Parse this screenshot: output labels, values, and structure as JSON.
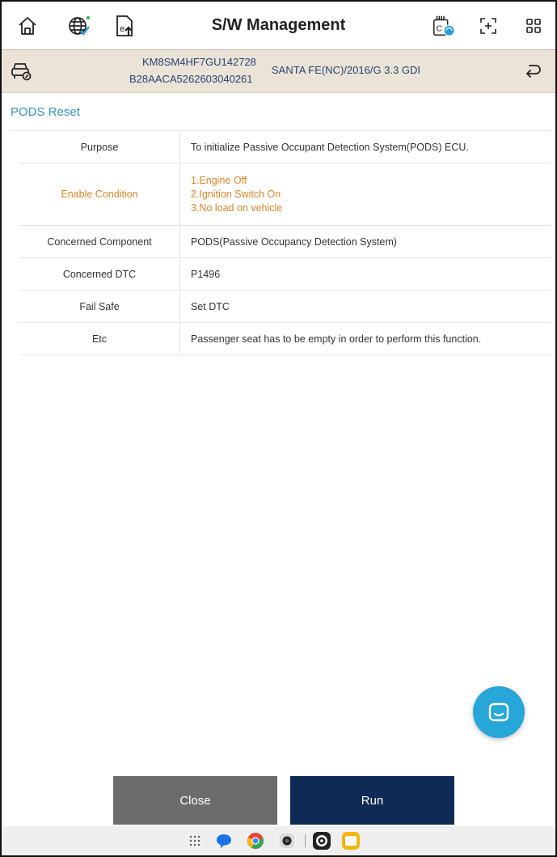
{
  "toolbar": {
    "title": "S/W Management",
    "icons": [
      "home-icon",
      "globe-check-icon",
      "ecu-upload-icon",
      "vci-status-icon",
      "screen-capture-icon",
      "menu-grid-icon"
    ]
  },
  "vehicle": {
    "vin": "KM8SM4HF7GU142728",
    "ecu_id": "B28AACA5262603040261",
    "model": "SANTA FE(NC)/2016/G 3.3 GDI"
  },
  "section": {
    "title": "PODS Reset"
  },
  "table": {
    "rows": [
      {
        "label": "Purpose",
        "value": "To initialize Passive Occupant Detection System(PODS) ECU."
      },
      {
        "label": "Enable Condition",
        "conditions": [
          "1.Engine Off",
          "2.Ignition Switch On",
          "3.No load on vehicle"
        ]
      },
      {
        "label": "Concerned Component",
        "value": "PODS(Passive Occupancy Detection System)"
      },
      {
        "label": "Concerned DTC",
        "value": "P1496"
      },
      {
        "label": "Fail Safe",
        "value": "Set DTC"
      },
      {
        "label": "Etc",
        "value": "Passenger seat has to be empty in order to perform this function."
      }
    ]
  },
  "buttons": {
    "close": "Close",
    "run": "Run"
  },
  "colors": {
    "accent": "#3a8fbf",
    "condition": "#d9852b",
    "run_button": "#0f2b55",
    "close_button": "#6c6c6c",
    "fab": "#27a6d8",
    "vehicle_bar": "#ece3d8"
  }
}
